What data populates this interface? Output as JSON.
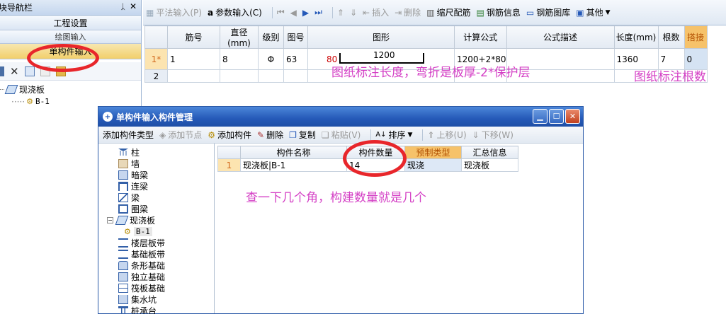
{
  "nav": {
    "title": "模块导航栏",
    "buttons": [
      "工程设置",
      "绘图输入",
      "单构件输入"
    ],
    "tree": {
      "root": "现浇板",
      "child": "B-1"
    }
  },
  "main_toolbar": {
    "items": [
      "平法输入(P)",
      "参数输入(C)",
      "插入",
      "删除",
      "缩尺配筋",
      "钢筋信息",
      "钢筋图库",
      "其他"
    ]
  },
  "grid": {
    "headers": [
      "筋号",
      "直径(mm)",
      "级别",
      "图号",
      "图形",
      "计算公式",
      "公式描述",
      "长度(mm)",
      "根数",
      "搭接"
    ],
    "rows": [
      {
        "hdr": "1*",
        "jinhao": "1",
        "diameter": "8",
        "grade": "Φ",
        "tuhao": "63",
        "shape_left": "80",
        "shape_len": "1200",
        "formula": "1200+2*80",
        "desc": "",
        "length": "1360",
        "count": "7",
        "lap": "0"
      },
      {
        "hdr": "2"
      }
    ]
  },
  "annotations": {
    "a1": "图纸标注长度，弯折是板厚-2*保护层",
    "a2": "图纸标注根数",
    "a3": "查一下几个角，构建数量就是几个"
  },
  "dialog": {
    "title": "单构件输入构件管理",
    "toolbar": [
      "添加构件类型",
      "添加节点",
      "添加构件",
      "删除",
      "复制",
      "粘贴(V)",
      "排序",
      "上移(U)",
      "下移(W)"
    ],
    "tree": [
      "柱",
      "墙",
      "暗梁",
      "连梁",
      "梁",
      "圈梁",
      "现浇板",
      "B-1",
      "楼层板带",
      "基础板带",
      "条形基础",
      "独立基础",
      "筏板基础",
      "集水坑",
      "桩承台"
    ],
    "grid_headers": [
      "构件名称",
      "构件数量",
      "预制类型",
      "汇总信息"
    ],
    "grid_row": {
      "hdr": "1",
      "name": "现浇板|B-1",
      "qty": "14",
      "type": "现浇",
      "summary": "现浇板"
    }
  },
  "colors": {
    "annotation": "#d43fc5",
    "circle": "#e8262b",
    "title_bar": "#2559b8",
    "orange_header": "#f6c26a"
  }
}
